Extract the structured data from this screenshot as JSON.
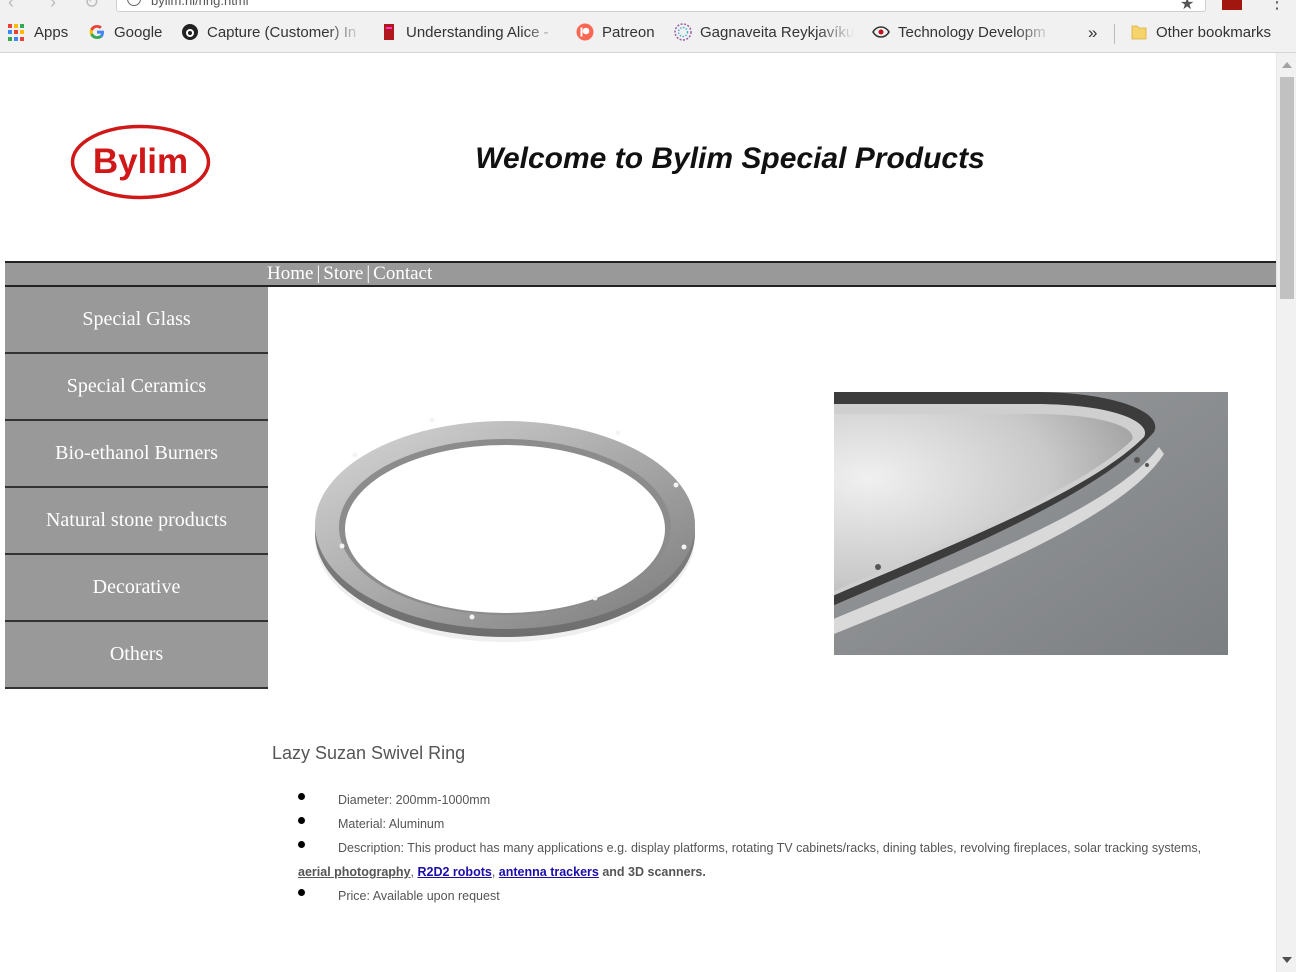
{
  "browser": {
    "url": "bylim.nl/ring.html",
    "bookmarks": [
      {
        "label": "Apps",
        "icon": "apps-grid-icon"
      },
      {
        "label": "Google",
        "icon": "google-icon"
      },
      {
        "label": "Capture (Customer) In",
        "icon": "capture-icon"
      },
      {
        "label": "Understanding Alice -",
        "icon": "book-icon"
      },
      {
        "label": "Patreon",
        "icon": "patreon-icon"
      },
      {
        "label": "Gagnaveita Reykjavíku",
        "icon": "gagnaveita-icon"
      },
      {
        "label": "Technology Developm",
        "icon": "eye-icon"
      }
    ],
    "overflow_label": "»",
    "other_bookmarks": "Other bookmarks"
  },
  "header": {
    "logo_text": "Bylim",
    "welcome": "Welcome to Bylim Special Products"
  },
  "nav": {
    "home": "Home",
    "store": "Store",
    "contact": "Contact",
    "separator": "|"
  },
  "sidebar": {
    "items": [
      {
        "label": "Special Glass"
      },
      {
        "label": "Special Ceramics"
      },
      {
        "label": "Bio-ethanol Burners"
      },
      {
        "label": "Natural stone products"
      },
      {
        "label": "Decorative"
      },
      {
        "label": "Others"
      }
    ]
  },
  "product": {
    "title": "Lazy Suzan Swivel Ring",
    "diameter": "Diameter: 200mm-1000mm",
    "material": "Material: Aluminum",
    "description_prefix": "Description: This product has many applications e.g. display platforms, rotating TV cabinets/racks, dining tables, revolving fireplaces, solar tracking systems,",
    "link_aerial": "aerial photography",
    "link_r2d2": "R2D2 robots",
    "link_antenna": "antenna trackers",
    "description_suffix": "and 3D scanners.",
    "comma": ",",
    "price": "Price: Available upon request"
  },
  "colors": {
    "menu_gray": "#999999",
    "logo_red": "#d01818",
    "link_blue": "#1a0dab"
  }
}
